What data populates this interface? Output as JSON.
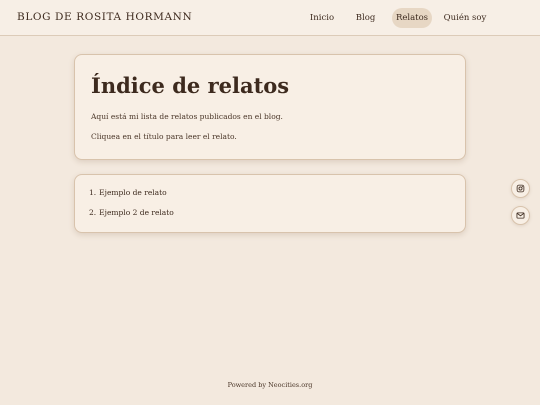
{
  "nav": {
    "brand": "BLOG DE ROSITA HORMANN",
    "items": [
      {
        "label": "Inicio",
        "active": false
      },
      {
        "label": "Blog",
        "active": false
      },
      {
        "label": "Relatos",
        "active": true
      },
      {
        "label": "Quién soy",
        "active": false
      }
    ]
  },
  "main": {
    "title": "Índice de relatos",
    "intro": "Aquí está mi lista de relatos publicados en el blog.",
    "hint": "Cliquea en el título para leer el relato.",
    "stories": [
      {
        "number": "1.",
        "title": "Ejemplo de relato"
      },
      {
        "number": "2.",
        "title": "Ejemplo 2 de relato"
      }
    ]
  },
  "side": {
    "instagram_icon": "instagram-icon",
    "mail_icon": "mail-icon"
  },
  "footer": {
    "text": "Powered by Neocities.org"
  },
  "colors": {
    "background": "#f3e9de",
    "card": "#f8efe5",
    "text": "#3d2a1e",
    "active_pill": "#e7d7c4",
    "border": "#d8c3ac"
  }
}
